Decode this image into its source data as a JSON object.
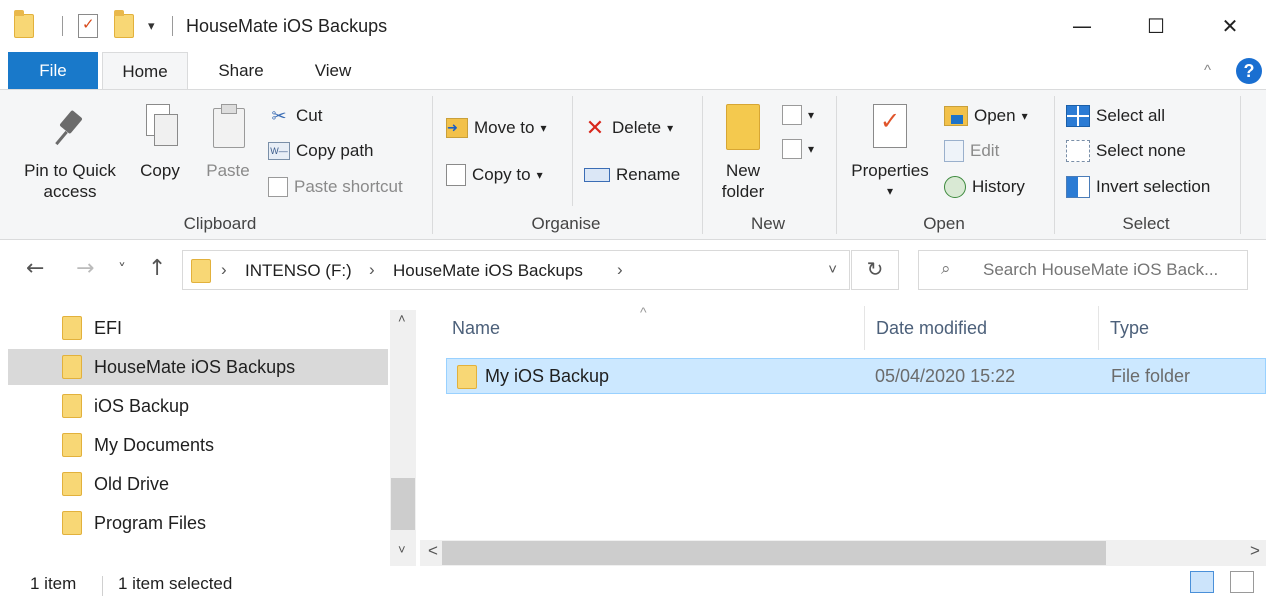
{
  "window": {
    "title": "HouseMate iOS Backups",
    "minimize_glyph": "—",
    "maximize_glyph": "☐",
    "close_glyph": "✕",
    "quick_access_dropdown": "▾"
  },
  "ribbon_tabs": [
    {
      "label": "File"
    },
    {
      "label": "Home"
    },
    {
      "label": "Share"
    },
    {
      "label": "View"
    }
  ],
  "ribbon_controls": {
    "collapse_glyph": "^",
    "help_glyph": "?"
  },
  "clipboard": {
    "group_label": "Clipboard",
    "pin_label_line1": "Pin to Quick",
    "pin_label_line2": "access",
    "copy_label": "Copy",
    "paste_label": "Paste",
    "cut_label": "Cut",
    "copy_path_label": "Copy path",
    "paste_shortcut_label": "Paste shortcut"
  },
  "organise": {
    "group_label": "Organise",
    "move_to_label": "Move to",
    "copy_to_label": "Copy to",
    "delete_label": "Delete",
    "rename_label": "Rename",
    "dropdown_glyph": "▾"
  },
  "new_group": {
    "group_label": "New",
    "new_folder_line1": "New",
    "new_folder_line2": "folder"
  },
  "open_group": {
    "group_label": "Open",
    "properties_label": "Properties",
    "open_label": "Open",
    "edit_label": "Edit",
    "history_label": "History"
  },
  "select_group": {
    "group_label": "Select",
    "select_all_label": "Select all",
    "select_none_label": "Select none",
    "invert_selection_label": "Invert selection"
  },
  "nav": {
    "back_glyph": "←",
    "forward_glyph": "→",
    "recent_glyph": "˅",
    "up_glyph": "↑",
    "crumbs": [
      "INTENSO (F:)",
      "HouseMate iOS Backups"
    ],
    "crumb_sep": "›",
    "address_dropdown": "˅",
    "refresh_glyph": "↻",
    "search_glyph": "⌕",
    "search_placeholder": "Search HouseMate iOS Back..."
  },
  "tree": [
    {
      "label": "EFI"
    },
    {
      "label": "HouseMate iOS Backups",
      "selected": true
    },
    {
      "label": "iOS Backup"
    },
    {
      "label": "My Documents"
    },
    {
      "label": "Old Drive"
    },
    {
      "label": "Program Files"
    }
  ],
  "scroll": {
    "up_glyph": "˄",
    "down_glyph": "˅",
    "left_glyph": "<",
    "right_glyph": ">"
  },
  "columns": {
    "name": "Name",
    "date_modified": "Date modified",
    "type": "Type",
    "sort_glyph": "^"
  },
  "files": [
    {
      "name": "My iOS Backup",
      "date_modified": "05/04/2020 15:22",
      "type": "File folder",
      "selected": true
    }
  ],
  "status": {
    "item_count": "1 item",
    "selection": "1 item selected"
  },
  "colors": {
    "file_tab": "#1979ca",
    "selection": "#cce8ff",
    "folder": "#f8d775",
    "help": "#1a6fd1"
  }
}
